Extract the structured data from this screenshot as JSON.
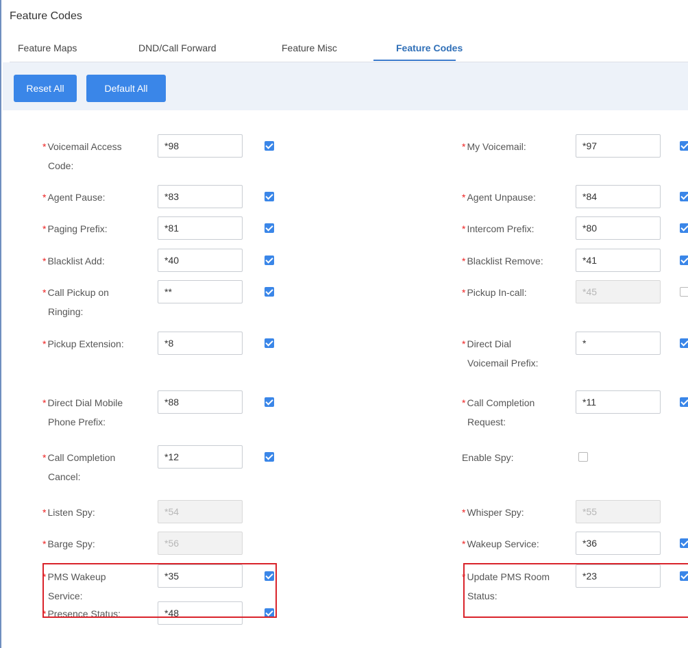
{
  "page": {
    "title": "Feature Codes"
  },
  "tabs": [
    {
      "label": "Feature Maps"
    },
    {
      "label": "DND/Call Forward"
    },
    {
      "label": "Feature Misc"
    },
    {
      "label": "Feature Codes",
      "active": true
    }
  ],
  "toolbar": {
    "reset_label": "Reset All",
    "default_label": "Default All"
  },
  "fields": [
    {
      "label": "Voicemail Access Code:",
      "value": "*98",
      "enabled": true,
      "required": true
    },
    {
      "label": "My Voicemail:",
      "value": "*97",
      "enabled": true,
      "required": true
    },
    {
      "label": "Agent Pause:",
      "value": "*83",
      "enabled": true,
      "required": true
    },
    {
      "label": "Agent Unpause:",
      "value": "*84",
      "enabled": true,
      "required": true
    },
    {
      "label": "Paging Prefix:",
      "value": "*81",
      "enabled": true,
      "required": true
    },
    {
      "label": "Intercom Prefix:",
      "value": "*80",
      "enabled": true,
      "required": true
    },
    {
      "label": "Blacklist Add:",
      "value": "*40",
      "enabled": true,
      "required": true
    },
    {
      "label": "Blacklist Remove:",
      "value": "*41",
      "enabled": true,
      "required": true
    },
    {
      "label": "Call Pickup on Ringing:",
      "value": "**",
      "enabled": true,
      "required": true
    },
    {
      "label": "Pickup In-call:",
      "value": "*45",
      "enabled": false,
      "required": true
    },
    {
      "label": "Pickup Extension:",
      "value": "*8",
      "enabled": true,
      "required": true
    },
    {
      "label": "Direct Dial Voicemail Prefix:",
      "value": "*",
      "enabled": true,
      "required": true
    },
    {
      "label": "Direct Dial Mobile Phone Prefix:",
      "value": "*88",
      "enabled": true,
      "required": true
    },
    {
      "label": "Call Completion Request:",
      "value": "*11",
      "enabled": true,
      "required": true
    },
    {
      "label": "Call Completion Cancel:",
      "value": "*12",
      "enabled": true,
      "required": true
    },
    {
      "label": "Enable Spy:",
      "value": "",
      "enabled": false,
      "required": false
    },
    {
      "label": "Listen Spy:",
      "value": "*54",
      "enabled": false,
      "required": true
    },
    {
      "label": "Whisper Spy:",
      "value": "*55",
      "enabled": false,
      "required": true
    },
    {
      "label": "Barge Spy:",
      "value": "*56",
      "enabled": false,
      "required": true
    },
    {
      "label": "Wakeup Service:",
      "value": "*36",
      "enabled": true,
      "required": true
    },
    {
      "label": "PMS Wakeup Service:",
      "value": "*35",
      "enabled": true,
      "required": true
    },
    {
      "label": "Update PMS Room Status:",
      "value": "*23",
      "enabled": true,
      "required": true
    },
    {
      "label": "Presence Status:",
      "value": "*48",
      "enabled": true,
      "required": true
    }
  ],
  "colors": {
    "accent": "#3a86e8",
    "highlight": "#d9222a",
    "required": "#e22222",
    "toolbar_bg": "#edf2f9"
  }
}
